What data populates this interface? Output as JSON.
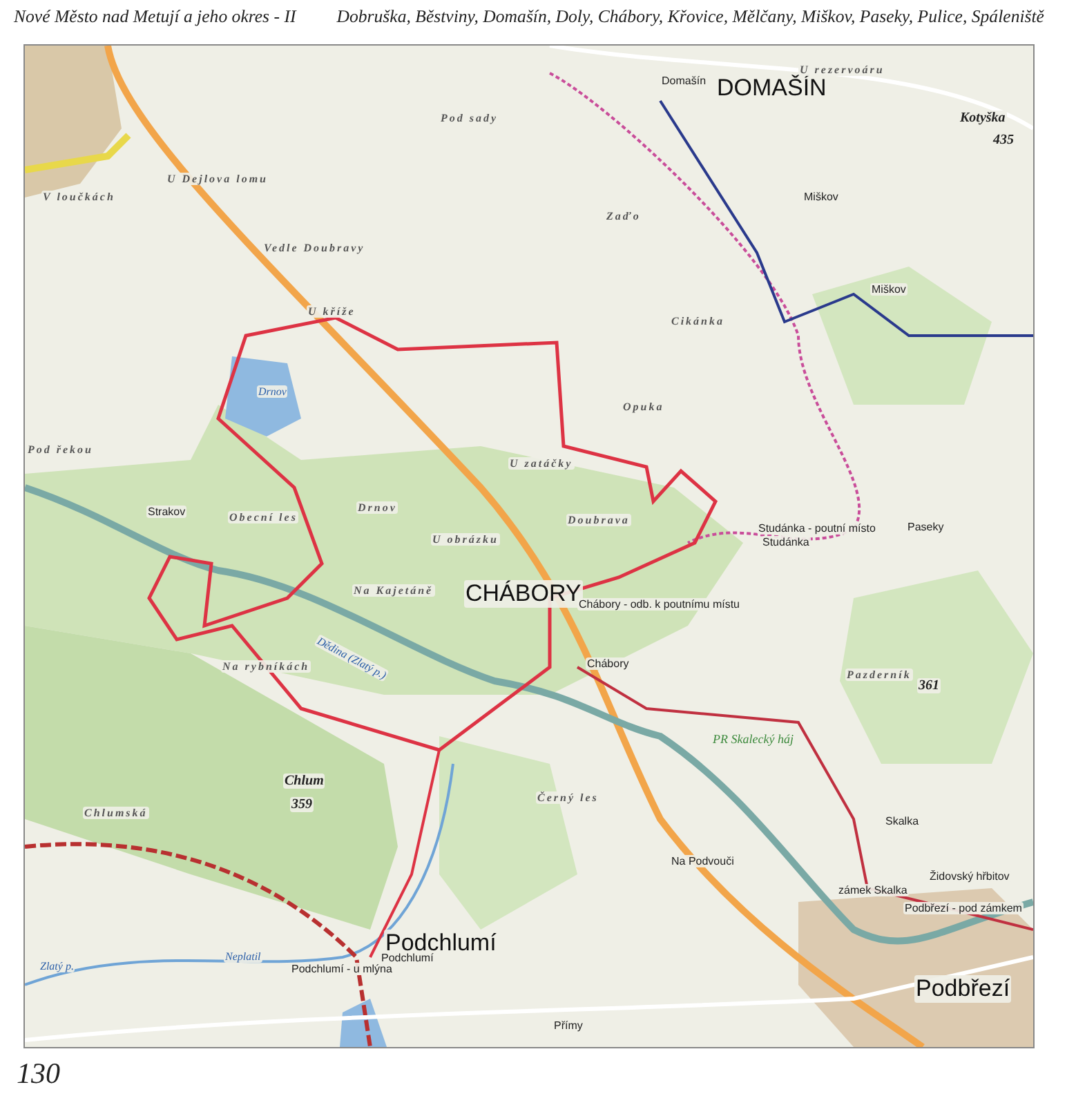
{
  "header": {
    "title": "Nové Město nad Metují a jeho okres - II",
    "places": "Dobruška, Běstviny, Domašín, Doly, Chábory, Křovice, Mělčany, Miškov, Paseky, Pulice, Spáleniště"
  },
  "map": {
    "labels": [
      {
        "text": "DOMAŠÍN",
        "kind": "village"
      },
      {
        "text": "CHÁBORY",
        "kind": "village"
      },
      {
        "text": "Podchlumí",
        "kind": "town"
      },
      {
        "text": "Podbřezí",
        "kind": "town"
      },
      {
        "text": "U rezervoáru",
        "kind": "locality"
      },
      {
        "text": "Kotyška",
        "kind": "peak"
      },
      {
        "text": "435",
        "kind": "peak"
      },
      {
        "text": "Pod sady",
        "kind": "locality"
      },
      {
        "text": "U Dejlova lomu",
        "kind": "locality"
      },
      {
        "text": "V loučkách",
        "kind": "locality"
      },
      {
        "text": "Vedle Doubravy",
        "kind": "locality"
      },
      {
        "text": "U kříže",
        "kind": "locality"
      },
      {
        "text": "Zaďo",
        "kind": "locality"
      },
      {
        "text": "Cikánka",
        "kind": "locality"
      },
      {
        "text": "Opuka",
        "kind": "locality"
      },
      {
        "text": "Pod řekou",
        "kind": "locality"
      },
      {
        "text": "Drnov",
        "kind": "water"
      },
      {
        "text": "Drnov",
        "kind": "locality"
      },
      {
        "text": "Obecní les",
        "kind": "locality"
      },
      {
        "text": "U obrázku",
        "kind": "locality"
      },
      {
        "text": "U zatáčky",
        "kind": "locality"
      },
      {
        "text": "Doubrava",
        "kind": "locality"
      },
      {
        "text": "Na Kajetáně",
        "kind": "locality"
      },
      {
        "text": "Na rybníkách",
        "kind": "locality"
      },
      {
        "text": "Chlumská",
        "kind": "locality"
      },
      {
        "text": "Chlum",
        "kind": "peak"
      },
      {
        "text": "359",
        "kind": "peak"
      },
      {
        "text": "Pazderník",
        "kind": "locality"
      },
      {
        "text": "361",
        "kind": "peak"
      },
      {
        "text": "Černý les",
        "kind": "locality"
      },
      {
        "text": "Domašín",
        "kind": "stop"
      },
      {
        "text": "Miškov",
        "kind": "stop"
      },
      {
        "text": "Miškov",
        "kind": "stop"
      },
      {
        "text": "Strakov",
        "kind": "stop"
      },
      {
        "text": "Studánka - poutní místo",
        "kind": "stop"
      },
      {
        "text": "Studánka",
        "kind": "stop"
      },
      {
        "text": "Paseky",
        "kind": "stop"
      },
      {
        "text": "Chábory - odb. k poutnímu místu",
        "kind": "stop"
      },
      {
        "text": "Chábory",
        "kind": "stop"
      },
      {
        "text": "Dědina (Zlatý p.)",
        "kind": "water"
      },
      {
        "text": "PR Skalecký háj",
        "kind": "reserve"
      },
      {
        "text": "Na Podvouči",
        "kind": "stop"
      },
      {
        "text": "Skalka",
        "kind": "stop"
      },
      {
        "text": "zámek Skalka",
        "kind": "stop"
      },
      {
        "text": "Židovský hřbitov",
        "kind": "stop"
      },
      {
        "text": "Podbřezí - pod zámkem",
        "kind": "stop"
      },
      {
        "text": "Podchlumí - u mlýna",
        "kind": "stop"
      },
      {
        "text": "Podchlumí",
        "kind": "stop"
      },
      {
        "text": "Neplatil",
        "kind": "water"
      },
      {
        "text": "Zlatý p.",
        "kind": "water"
      },
      {
        "text": "Přímy",
        "kind": "stop"
      }
    ]
  },
  "page_number": "130"
}
